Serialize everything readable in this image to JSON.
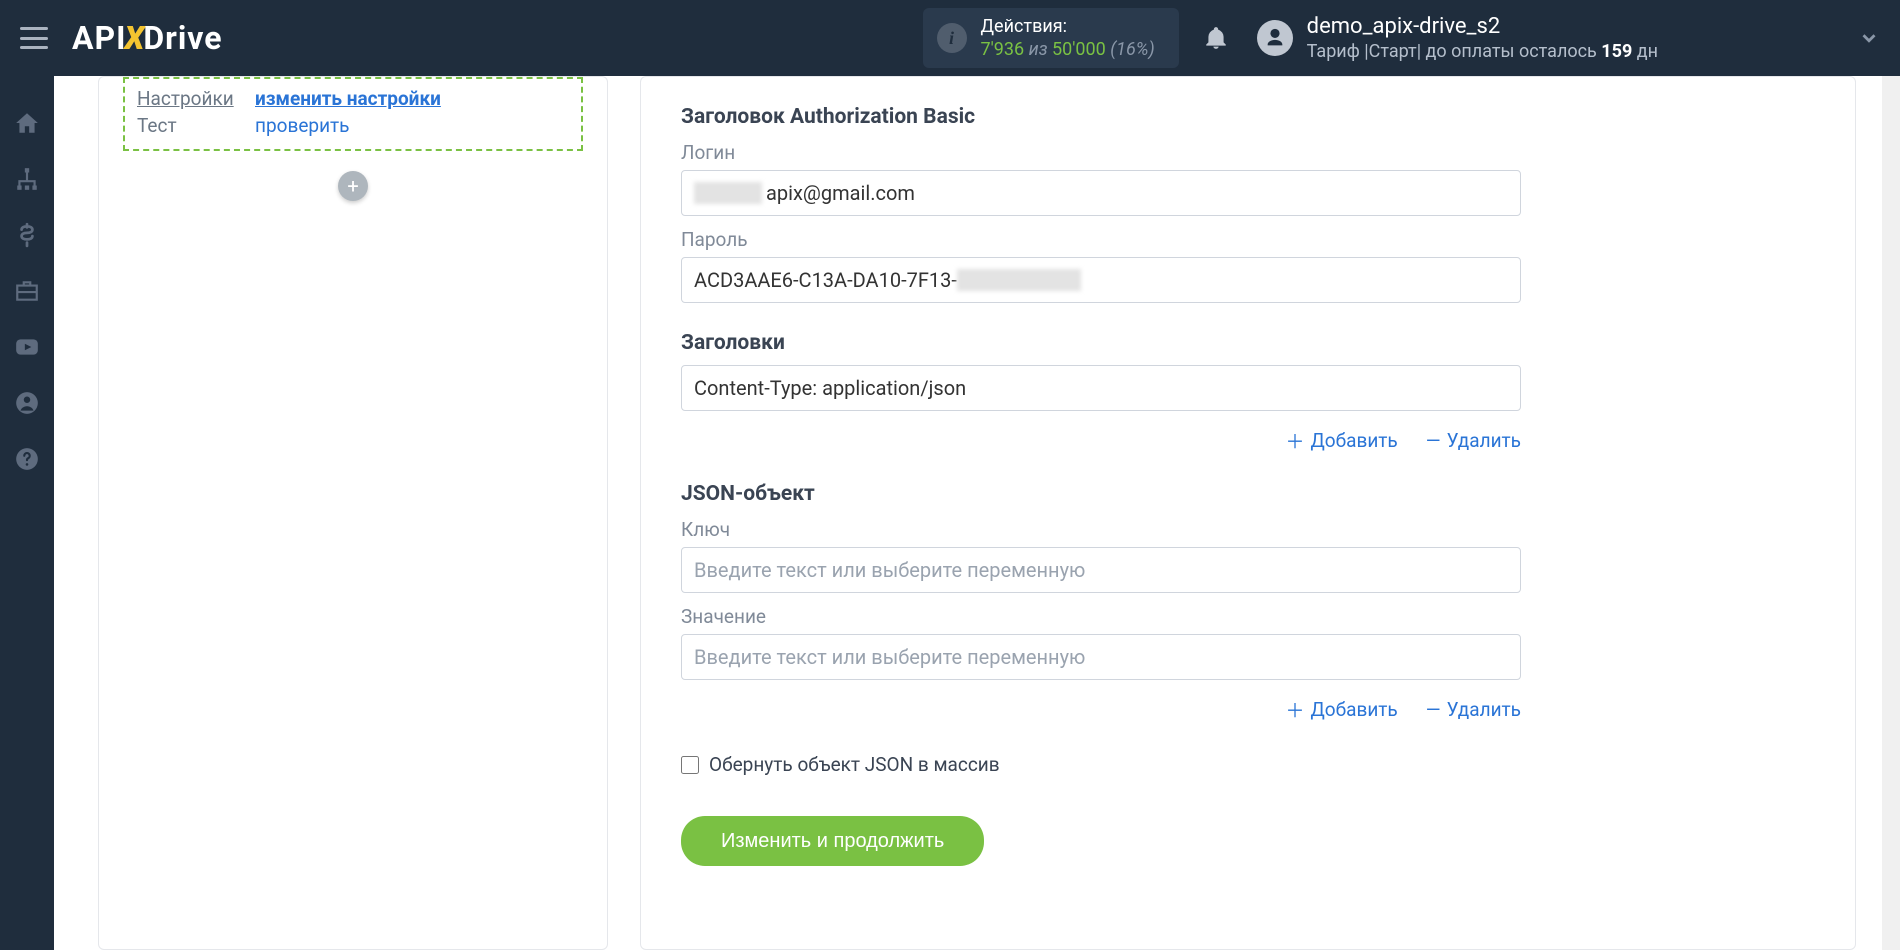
{
  "header": {
    "logo_api": "API",
    "logo_drive": "Drive",
    "actions_label": "Действия:",
    "actions_used": "7'936",
    "actions_of_word": "из",
    "actions_total": "50'000",
    "actions_pct": "(16%)",
    "user_name": "demo_apix-drive_s2",
    "tariff_prefix": "Тариф |Старт| до оплаты осталось ",
    "tariff_days": "159",
    "tariff_suffix": " дн"
  },
  "left": {
    "settings_label": "Настройки",
    "settings_link": "изменить настройки",
    "test_label": "Тест",
    "test_link": "проверить"
  },
  "form": {
    "auth_header": "Заголовок Authorization Basic",
    "login_label": "Логин",
    "login_value": "apix@gmail.com",
    "password_label": "Пароль",
    "password_value": "ACD3AAE6-C13A-DA10-7F13-",
    "headers_label": "Заголовки",
    "headers_value": "Content-Type: application/json",
    "add_label": "Добавить",
    "delete_label": "Удалить",
    "json_header": "JSON-объект",
    "key_label": "Ключ",
    "value_label": "Значение",
    "placeholder": "Введите текст или выберите переменную",
    "wrap_array_label": "Обернуть объект JSON в массив",
    "submit_label": "Изменить и продолжить"
  }
}
